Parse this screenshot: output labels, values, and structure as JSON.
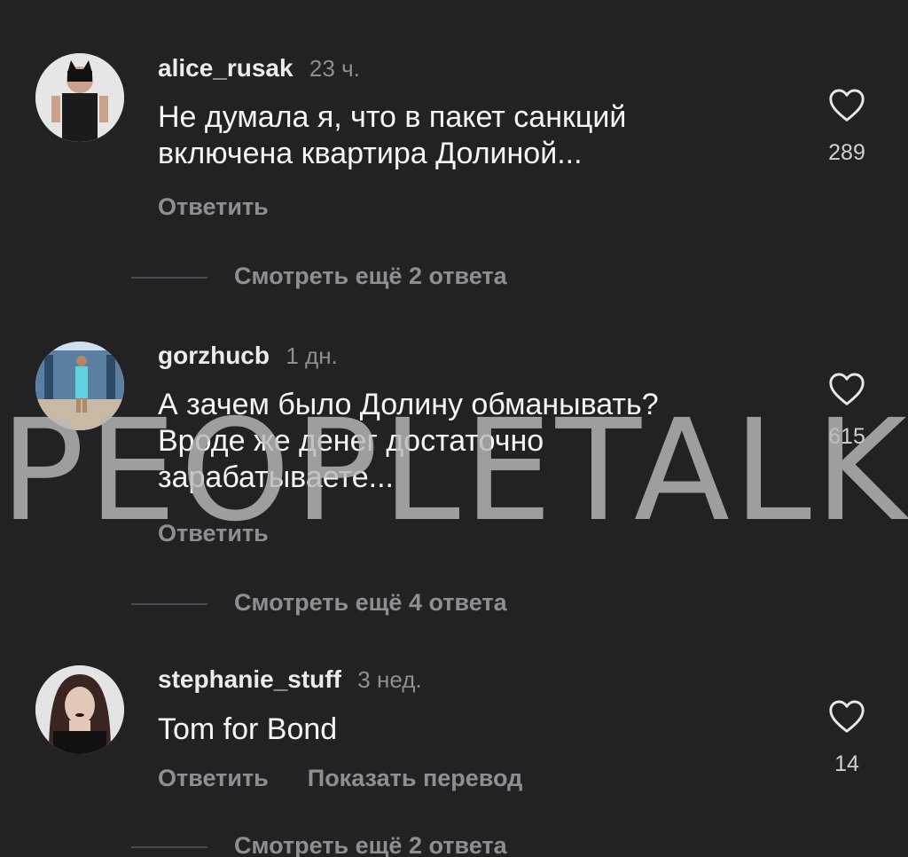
{
  "comments": [
    {
      "username": "alice_rusak",
      "time": "23 ч.",
      "text": "Не думала я, что в пакет санкций\nвключена квартира Долиной...",
      "reply": "Ответить",
      "likes": "289",
      "view_more": "Смотреть ещё 2 ответа"
    },
    {
      "username": "gorzhucb",
      "time": "1 дн.",
      "text": "А зачем было Долину обманывать?\nВроде же денег достаточно\nзарабатываете...",
      "reply": "Ответить",
      "likes": "615",
      "view_more": "Смотреть ещё 4 ответа"
    },
    {
      "username": "stephanie_stuff",
      "time": "3 нед.",
      "text": "Tom for Bond",
      "reply": "Ответить",
      "translate": "Показать перевод",
      "likes": "14",
      "view_more": "Смотреть ещё 2 ответа"
    }
  ],
  "watermark": "PEOPLETALK",
  "icons": {
    "like": "heart-outline-icon"
  },
  "colors": {
    "background": "#222225",
    "secondary_text": "#8e8e93",
    "primary_text": "#f5f5f5"
  }
}
